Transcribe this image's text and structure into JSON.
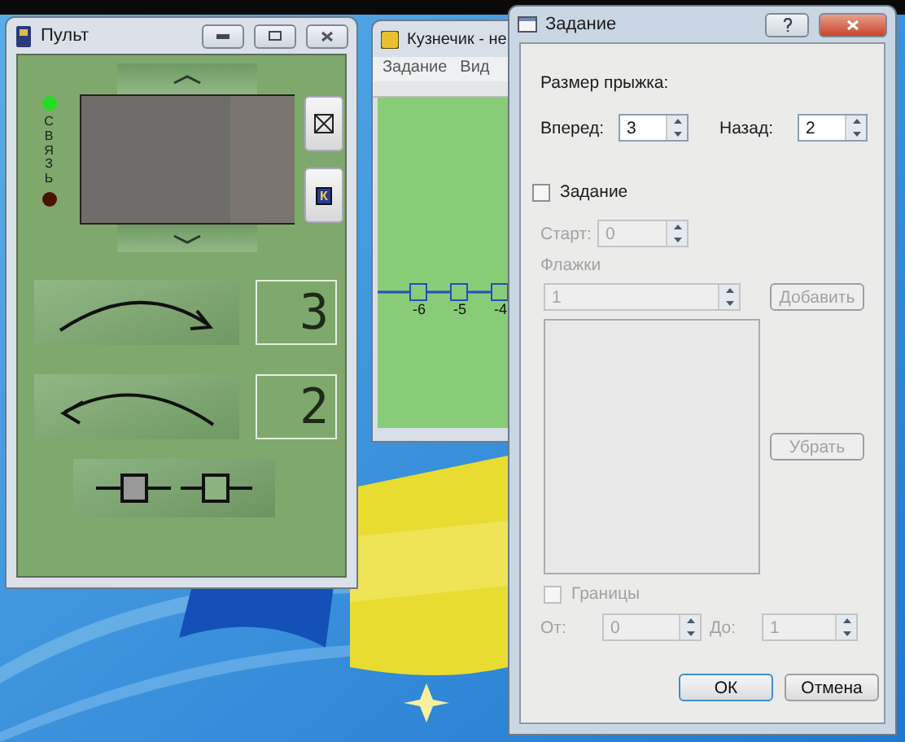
{
  "remote": {
    "title": "Пульт",
    "link_label": "СВЯЗЬ",
    "leds": [
      {
        "color": "#22dd22"
      },
      {
        "color": "#4a1200"
      }
    ],
    "key_label": "К",
    "counters": [
      {
        "kind": "forward",
        "value": "3"
      },
      {
        "kind": "back",
        "value": "2"
      }
    ]
  },
  "main_window": {
    "title": "Кузнечик - не",
    "menu": [
      "Задание",
      "Вид"
    ],
    "ticks": [
      "-6",
      "-5",
      "-4"
    ]
  },
  "dialog": {
    "title": "Задание",
    "jump_size_label": "Размер прыжка:",
    "forward": {
      "label": "Вперед:",
      "value": "3"
    },
    "back": {
      "label": "Назад:",
      "value": "2"
    },
    "task": {
      "label": "Задание",
      "checked": false
    },
    "start": {
      "label": "Старт:",
      "value": "0",
      "disabled": true
    },
    "flags": {
      "label": "Флажки",
      "value": "1",
      "disabled": true
    },
    "add_button": {
      "label": "Добавить",
      "disabled": true
    },
    "remove_button": {
      "label": "Убрать",
      "disabled": true
    },
    "bounds": {
      "label": "Границы",
      "checked": false,
      "disabled": true
    },
    "from": {
      "label": "От:",
      "value": "0",
      "disabled": true
    },
    "to": {
      "label": "До:",
      "value": "1",
      "disabled": true
    },
    "ok_button": "ОК",
    "cancel_button": "Отмена"
  }
}
